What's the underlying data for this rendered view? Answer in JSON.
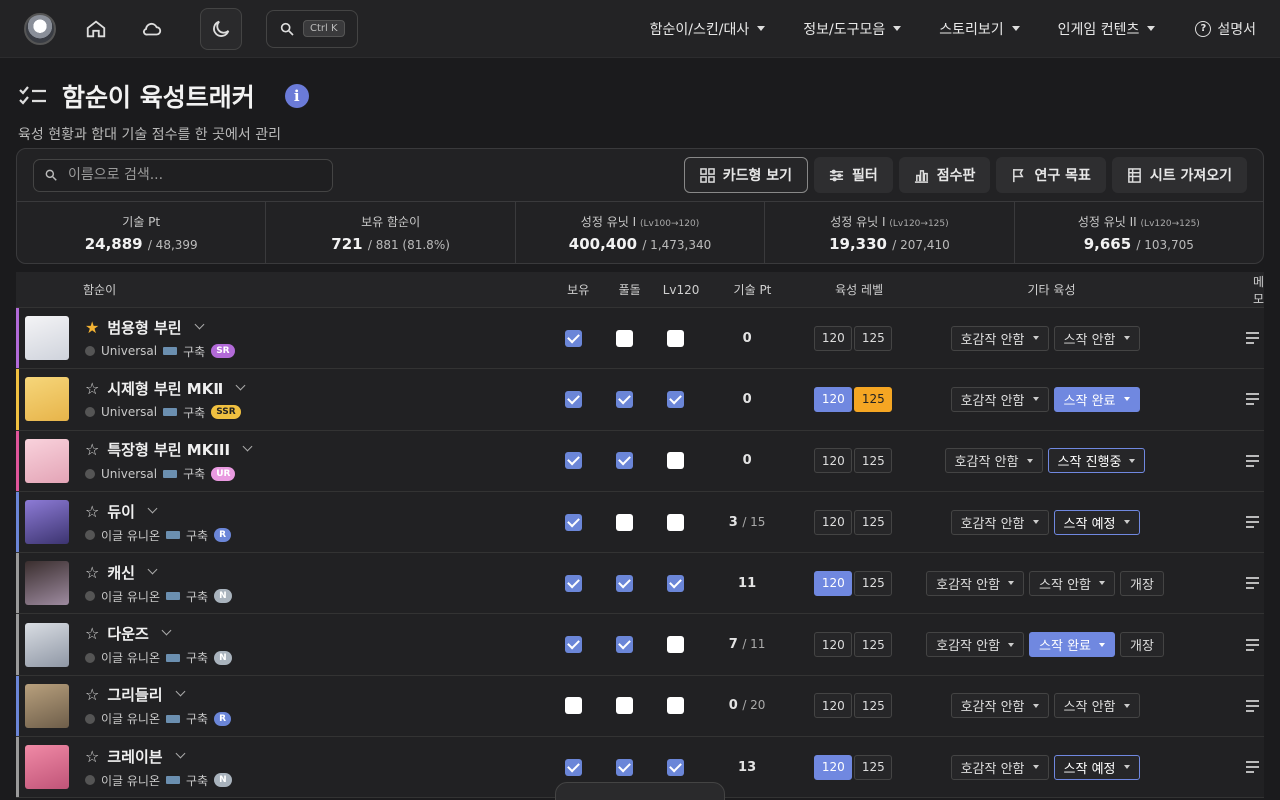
{
  "topbar": {
    "search_shortcut": "Ctrl K",
    "nav": [
      "함순이/스킨/대사",
      "정보/도구모음",
      "스토리보기",
      "인게임 컨텐츠"
    ],
    "help": "설명서"
  },
  "page": {
    "title": "함순이 육성트래커",
    "subtitle": "육성 현황과 함대 기술 점수를 한 곳에서 관리"
  },
  "toolbar": {
    "search_placeholder": "이름으로 검색...",
    "card_view": "카드형 보기",
    "filter": "필터",
    "scoreboard": "점수판",
    "research": "연구 목표",
    "import": "시트 가져오기"
  },
  "stats": [
    {
      "label": "기술 Pt",
      "sub": "",
      "value": "24,889",
      "total": "/ 48,399"
    },
    {
      "label": "보유 함순이",
      "sub": "",
      "value": "721",
      "total": "/ 881 (81.8%)"
    },
    {
      "label": "성정 유닛 I",
      "sub": "(Lv100→120)",
      "value": "400,400",
      "total": "/ 1,473,340"
    },
    {
      "label": "성정 유닛 I",
      "sub": "(Lv120→125)",
      "value": "19,330",
      "total": "/ 207,410"
    },
    {
      "label": "성정 유닛 II",
      "sub": "(Lv120→125)",
      "value": "9,665",
      "total": "/ 103,705"
    }
  ],
  "table": {
    "headers": {
      "name": "함순이",
      "own": "보유",
      "full": "풀돌",
      "lv120": "Lv120",
      "pt": "기술 Pt",
      "level": "육성 레벨",
      "other": "기타 육성",
      "memo": "메모"
    },
    "rows": [
      {
        "fav": true,
        "name": "범용형 부린",
        "faction": "Universal",
        "type": "구축",
        "rarity": "SR",
        "rarity_color": "#b26ad8",
        "bar_color": "#b26ad8",
        "own": true,
        "full": false,
        "lv120": false,
        "pt": "0",
        "pt_total": "",
        "lv": [
          "none",
          "none"
        ],
        "levels": [
          "120",
          "125"
        ],
        "other": [
          {
            "label": "호감작 안함",
            "state": "none"
          },
          {
            "label": "스작 안함",
            "state": "none"
          }
        ]
      },
      {
        "fav": false,
        "name": "시제형 부린 MKⅡ",
        "faction": "Universal",
        "type": "구축",
        "rarity": "SSR",
        "rarity_color": "#f0c040",
        "bar_color": "#f0c040",
        "own": true,
        "full": true,
        "lv120": true,
        "pt": "0",
        "pt_total": "",
        "lv": [
          "blue",
          "gold"
        ],
        "levels": [
          "120",
          "125"
        ],
        "other": [
          {
            "label": "호감작 안함",
            "state": "none"
          },
          {
            "label": "스작 완료",
            "state": "done"
          }
        ]
      },
      {
        "fav": false,
        "name": "특장형 부린 MKIII",
        "faction": "Universal",
        "type": "구축",
        "rarity": "UR",
        "rarity_color": "#e99ae0",
        "bar_color": "#e0559a",
        "own": true,
        "full": true,
        "lv120": false,
        "pt": "0",
        "pt_total": "",
        "lv": [
          "none",
          "none"
        ],
        "levels": [
          "120",
          "125"
        ],
        "other": [
          {
            "label": "호감작 안함",
            "state": "none"
          },
          {
            "label": "스작 진행중",
            "state": "prog"
          }
        ]
      },
      {
        "fav": false,
        "name": "듀이",
        "faction": "이글 유니온",
        "type": "구축",
        "rarity": "R",
        "rarity_color": "#6b86d8",
        "bar_color": "#6b86d8",
        "own": true,
        "full": false,
        "lv120": false,
        "pt": "3",
        "pt_total": "/ 15",
        "lv": [
          "none",
          "none"
        ],
        "levels": [
          "120",
          "125"
        ],
        "other": [
          {
            "label": "호감작 안함",
            "state": "none"
          },
          {
            "label": "스작 예정",
            "state": "prog"
          }
        ]
      },
      {
        "fav": false,
        "name": "캐신",
        "faction": "이글 유니온",
        "type": "구축",
        "rarity": "N",
        "rarity_color": "#a9b3bd",
        "bar_color": "#9a9a9a",
        "own": true,
        "full": true,
        "lv120": true,
        "pt": "11",
        "pt_total": "",
        "lv": [
          "blue",
          "none"
        ],
        "levels": [
          "120",
          "125"
        ],
        "other": [
          {
            "label": "호감작 안함",
            "state": "none"
          },
          {
            "label": "스작 안함",
            "state": "none"
          },
          {
            "label": "개장",
            "state": "plain"
          }
        ]
      },
      {
        "fav": false,
        "name": "다운즈",
        "faction": "이글 유니온",
        "type": "구축",
        "rarity": "N",
        "rarity_color": "#a9b3bd",
        "bar_color": "#9a9a9a",
        "own": true,
        "full": true,
        "lv120": false,
        "pt": "7",
        "pt_total": "/ 11",
        "lv": [
          "none",
          "none"
        ],
        "levels": [
          "120",
          "125"
        ],
        "other": [
          {
            "label": "호감작 안함",
            "state": "none"
          },
          {
            "label": "스작 완료",
            "state": "done"
          },
          {
            "label": "개장",
            "state": "plain"
          }
        ]
      },
      {
        "fav": false,
        "name": "그리들리",
        "faction": "이글 유니온",
        "type": "구축",
        "rarity": "R",
        "rarity_color": "#6b86d8",
        "bar_color": "#6b86d8",
        "own": false,
        "full": false,
        "lv120": false,
        "pt": "0",
        "pt_total": "/ 20",
        "lv": [
          "none",
          "none"
        ],
        "levels": [
          "120",
          "125"
        ],
        "other": [
          {
            "label": "호감작 안함",
            "state": "none"
          },
          {
            "label": "스작 안함",
            "state": "none"
          }
        ]
      },
      {
        "fav": false,
        "name": "크레이븐",
        "faction": "이글 유니온",
        "type": "구축",
        "rarity": "N",
        "rarity_color": "#a9b3bd",
        "bar_color": "#9a9a9a",
        "own": true,
        "full": true,
        "lv120": true,
        "pt": "13",
        "pt_total": "",
        "lv": [
          "blue",
          "none"
        ],
        "levels": [
          "120",
          "125"
        ],
        "other": [
          {
            "label": "호감작 안함",
            "state": "none"
          },
          {
            "label": "스작 예정",
            "state": "prog"
          }
        ]
      }
    ]
  }
}
